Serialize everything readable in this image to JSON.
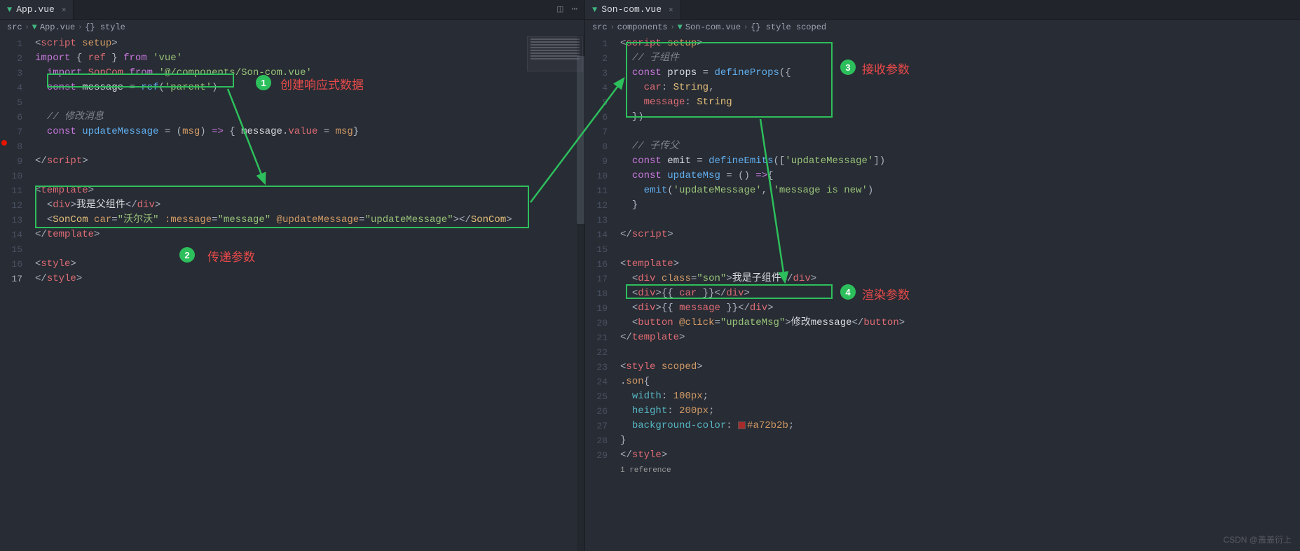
{
  "left": {
    "tab": {
      "name": "App.vue"
    },
    "breadcrumb": [
      "src",
      "App.vue",
      "{} style"
    ],
    "lines": {
      "1": [
        {
          "t": "<",
          "c": "c-tag"
        },
        {
          "t": "script",
          "c": "c-var"
        },
        {
          "t": " setup",
          "c": "c-attr"
        },
        {
          "t": ">",
          "c": "c-tag"
        }
      ],
      "2": [
        {
          "t": "import",
          "c": "c-keyword"
        },
        {
          "t": " { "
        },
        {
          "t": "ref",
          "c": "c-var"
        },
        {
          "t": " } "
        },
        {
          "t": "from",
          "c": "c-keyword"
        },
        {
          "t": " "
        },
        {
          "t": "'vue'",
          "c": "c-string"
        }
      ],
      "3": [
        {
          "t": "  "
        },
        {
          "t": "import",
          "c": "c-keyword"
        },
        {
          "t": " "
        },
        {
          "t": "SonCom",
          "c": "c-var"
        },
        {
          "t": " "
        },
        {
          "t": "from",
          "c": "c-keyword"
        },
        {
          "t": " "
        },
        {
          "t": "'@/components/Son-com.vue'",
          "c": "c-string"
        }
      ],
      "4": [
        {
          "t": "  "
        },
        {
          "t": "const",
          "c": "c-keyword"
        },
        {
          "t": " "
        },
        {
          "t": "message",
          "c": "c-white"
        },
        {
          "t": " = "
        },
        {
          "t": "ref",
          "c": "c-blue"
        },
        {
          "t": "("
        },
        {
          "t": "'parent'",
          "c": "c-string"
        },
        {
          "t": ")"
        }
      ],
      "5": [
        {
          "t": " "
        }
      ],
      "6": [
        {
          "t": "  "
        },
        {
          "t": "// 修改消息",
          "c": "c-comment"
        }
      ],
      "7": [
        {
          "t": "  "
        },
        {
          "t": "const",
          "c": "c-keyword"
        },
        {
          "t": " "
        },
        {
          "t": "updateMessage",
          "c": "c-blue"
        },
        {
          "t": " = ("
        },
        {
          "t": "msg",
          "c": "c-attr"
        },
        {
          "t": ") "
        },
        {
          "t": "=>",
          "c": "c-keyword"
        },
        {
          "t": " { "
        },
        {
          "t": "message",
          "c": "c-white"
        },
        {
          "t": "."
        },
        {
          "t": "value",
          "c": "c-var"
        },
        {
          "t": " = "
        },
        {
          "t": "msg",
          "c": "c-attr"
        },
        {
          "t": "}"
        }
      ],
      "8": [
        {
          "t": " "
        }
      ],
      "9": [
        {
          "t": "</",
          "c": "c-tag"
        },
        {
          "t": "script",
          "c": "c-var"
        },
        {
          "t": ">",
          "c": "c-tag"
        }
      ],
      "10": [
        {
          "t": " "
        }
      ],
      "11": [
        {
          "t": "<",
          "c": "c-tag"
        },
        {
          "t": "template",
          "c": "c-var"
        },
        {
          "t": ">",
          "c": "c-tag"
        }
      ],
      "12": [
        {
          "t": "  "
        },
        {
          "t": "<",
          "c": "c-tag"
        },
        {
          "t": "div",
          "c": "c-var"
        },
        {
          "t": ">",
          "c": "c-tag"
        },
        {
          "t": "我是父组件",
          "c": "c-white"
        },
        {
          "t": "</",
          "c": "c-tag"
        },
        {
          "t": "div",
          "c": "c-var"
        },
        {
          "t": ">",
          "c": "c-tag"
        }
      ],
      "13": [
        {
          "t": "  "
        },
        {
          "t": "<",
          "c": "c-tag"
        },
        {
          "t": "SonCom",
          "c": "c-component"
        },
        {
          "t": " "
        },
        {
          "t": "car",
          "c": "c-attr"
        },
        {
          "t": "="
        },
        {
          "t": "\"沃尔沃\"",
          "c": "c-string"
        },
        {
          "t": " "
        },
        {
          "t": ":message",
          "c": "c-attr"
        },
        {
          "t": "="
        },
        {
          "t": "\"message\"",
          "c": "c-string"
        },
        {
          "t": " "
        },
        {
          "t": "@updateMessage",
          "c": "c-attr"
        },
        {
          "t": "="
        },
        {
          "t": "\"updateMessage\"",
          "c": "c-string"
        },
        {
          "t": ">",
          "c": "c-tag"
        },
        {
          "t": "</",
          "c": "c-tag"
        },
        {
          "t": "SonCom",
          "c": "c-component"
        },
        {
          "t": ">",
          "c": "c-tag"
        }
      ],
      "14": [
        {
          "t": "</",
          "c": "c-tag"
        },
        {
          "t": "template",
          "c": "c-var"
        },
        {
          "t": ">",
          "c": "c-tag"
        }
      ],
      "15": [
        {
          "t": " "
        }
      ],
      "16": [
        {
          "t": "<",
          "c": "c-tag"
        },
        {
          "t": "style",
          "c": "c-var"
        },
        {
          "t": ">",
          "c": "c-tag"
        }
      ],
      "17": [
        {
          "t": "</",
          "c": "c-tag"
        },
        {
          "t": "style",
          "c": "c-var"
        },
        {
          "t": ">",
          "c": "c-tag"
        }
      ]
    },
    "annotations": {
      "1": "创建响应式数据",
      "2": "传递参数"
    }
  },
  "right": {
    "tab": {
      "name": "Son-com.vue"
    },
    "breadcrumb": [
      "src",
      "components",
      "Son-com.vue",
      "{} style scoped"
    ],
    "lines": {
      "1": [
        {
          "t": "<",
          "c": "c-tag"
        },
        {
          "t": "script",
          "c": "c-var"
        },
        {
          "t": " setup",
          "c": "c-attr"
        },
        {
          "t": ">",
          "c": "c-tag"
        }
      ],
      "2": [
        {
          "t": "  "
        },
        {
          "t": "// 子组件",
          "c": "c-comment"
        }
      ],
      "3": [
        {
          "t": "  "
        },
        {
          "t": "const",
          "c": "c-keyword"
        },
        {
          "t": " "
        },
        {
          "t": "props",
          "c": "c-white"
        },
        {
          "t": " = "
        },
        {
          "t": "defineProps",
          "c": "c-blue"
        },
        {
          "t": "({"
        }
      ],
      "4": [
        {
          "t": "    "
        },
        {
          "t": "car",
          "c": "c-var"
        },
        {
          "t": ": "
        },
        {
          "t": "String",
          "c": "c-component"
        },
        {
          "t": ","
        }
      ],
      "5": [
        {
          "t": "    "
        },
        {
          "t": "message",
          "c": "c-var"
        },
        {
          "t": ": "
        },
        {
          "t": "String",
          "c": "c-component"
        }
      ],
      "6": [
        {
          "t": "  })"
        }
      ],
      "7": [
        {
          "t": " "
        }
      ],
      "8": [
        {
          "t": "  "
        },
        {
          "t": "// 子传父",
          "c": "c-comment"
        }
      ],
      "9": [
        {
          "t": "  "
        },
        {
          "t": "const",
          "c": "c-keyword"
        },
        {
          "t": " "
        },
        {
          "t": "emit",
          "c": "c-white"
        },
        {
          "t": " = "
        },
        {
          "t": "defineEmits",
          "c": "c-blue"
        },
        {
          "t": "(["
        },
        {
          "t": "'updateMessage'",
          "c": "c-string"
        },
        {
          "t": "])"
        }
      ],
      "10": [
        {
          "t": "  "
        },
        {
          "t": "const",
          "c": "c-keyword"
        },
        {
          "t": " "
        },
        {
          "t": "updateMsg",
          "c": "c-blue"
        },
        {
          "t": " = () "
        },
        {
          "t": "=>",
          "c": "c-keyword"
        },
        {
          "t": "{"
        }
      ],
      "11": [
        {
          "t": "    "
        },
        {
          "t": "emit",
          "c": "c-blue"
        },
        {
          "t": "("
        },
        {
          "t": "'updateMessage'",
          "c": "c-string"
        },
        {
          "t": ", "
        },
        {
          "t": "'message is new'",
          "c": "c-string"
        },
        {
          "t": ")"
        }
      ],
      "12": [
        {
          "t": "  }"
        }
      ],
      "13": [
        {
          "t": " "
        }
      ],
      "14": [
        {
          "t": "</",
          "c": "c-tag"
        },
        {
          "t": "script",
          "c": "c-var"
        },
        {
          "t": ">",
          "c": "c-tag"
        }
      ],
      "15": [
        {
          "t": " "
        }
      ],
      "16": [
        {
          "t": "<",
          "c": "c-tag"
        },
        {
          "t": "template",
          "c": "c-var"
        },
        {
          "t": ">",
          "c": "c-tag"
        }
      ],
      "17": [
        {
          "t": "  "
        },
        {
          "t": "<",
          "c": "c-tag"
        },
        {
          "t": "div",
          "c": "c-var"
        },
        {
          "t": " "
        },
        {
          "t": "class",
          "c": "c-attr"
        },
        {
          "t": "="
        },
        {
          "t": "\"",
          "c": "c-string"
        },
        {
          "t": "son",
          "c": "c-string underline"
        },
        {
          "t": "\"",
          "c": "c-string"
        },
        {
          "t": ">",
          "c": "c-tag"
        },
        {
          "t": "我是子组件",
          "c": "c-white"
        },
        {
          "t": "</",
          "c": "c-tag"
        },
        {
          "t": "div",
          "c": "c-var"
        },
        {
          "t": ">",
          "c": "c-tag"
        }
      ],
      "18": [
        {
          "t": "  "
        },
        {
          "t": "<",
          "c": "c-tag"
        },
        {
          "t": "div",
          "c": "c-var"
        },
        {
          "t": ">",
          "c": "c-tag"
        },
        {
          "t": "{{ "
        },
        {
          "t": "car",
          "c": "c-var"
        },
        {
          "t": " }}"
        },
        {
          "t": "</",
          "c": "c-tag"
        },
        {
          "t": "div",
          "c": "c-var"
        },
        {
          "t": ">",
          "c": "c-tag"
        }
      ],
      "19": [
        {
          "t": "  "
        },
        {
          "t": "<",
          "c": "c-tag"
        },
        {
          "t": "div",
          "c": "c-var"
        },
        {
          "t": ">",
          "c": "c-tag"
        },
        {
          "t": "{{ "
        },
        {
          "t": "message",
          "c": "c-var"
        },
        {
          "t": " }}"
        },
        {
          "t": "</",
          "c": "c-tag"
        },
        {
          "t": "div",
          "c": "c-var"
        },
        {
          "t": ">",
          "c": "c-tag"
        }
      ],
      "20": [
        {
          "t": "  "
        },
        {
          "t": "<",
          "c": "c-tag"
        },
        {
          "t": "button",
          "c": "c-var"
        },
        {
          "t": " "
        },
        {
          "t": "@click",
          "c": "c-attr"
        },
        {
          "t": "="
        },
        {
          "t": "\"updateMsg\"",
          "c": "c-string"
        },
        {
          "t": ">",
          "c": "c-tag"
        },
        {
          "t": "修改message",
          "c": "c-white"
        },
        {
          "t": "</",
          "c": "c-tag"
        },
        {
          "t": "button",
          "c": "c-var"
        },
        {
          "t": ">",
          "c": "c-tag"
        }
      ],
      "21": [
        {
          "t": "</",
          "c": "c-tag"
        },
        {
          "t": "template",
          "c": "c-var"
        },
        {
          "t": ">",
          "c": "c-tag"
        }
      ],
      "22": [
        {
          "t": " "
        }
      ],
      "23": [
        {
          "t": "<",
          "c": "c-tag"
        },
        {
          "t": "style",
          "c": "c-var"
        },
        {
          "t": " scoped",
          "c": "c-attr"
        },
        {
          "t": ">",
          "c": "c-tag"
        }
      ],
      "ref": [
        {
          "t": "1 reference",
          "c": "c-ref"
        }
      ],
      "24": [
        {
          "t": "."
        },
        {
          "t": "son",
          "c": "c-attr"
        },
        {
          "t": "{"
        }
      ],
      "25": [
        {
          "t": "  "
        },
        {
          "t": "width",
          "c": "c-func"
        },
        {
          "t": ": "
        },
        {
          "t": "100px",
          "c": "c-attr"
        },
        {
          "t": ";"
        }
      ],
      "26": [
        {
          "t": "  "
        },
        {
          "t": "height",
          "c": "c-func"
        },
        {
          "t": ": "
        },
        {
          "t": "200px",
          "c": "c-attr"
        },
        {
          "t": ";"
        }
      ],
      "27": [
        {
          "t": "  "
        },
        {
          "t": "background-color",
          "c": "c-func"
        },
        {
          "t": ": "
        },
        {
          "t": "SWATCH",
          "c": "swatch"
        },
        {
          "t": "#a72b2b",
          "c": "c-attr"
        },
        {
          "t": ";"
        }
      ],
      "28": [
        {
          "t": "}"
        }
      ],
      "29": [
        {
          "t": "</",
          "c": "c-tag"
        },
        {
          "t": "style",
          "c": "c-var"
        },
        {
          "t": ">",
          "c": "c-tag"
        }
      ]
    },
    "annotations": {
      "3": "接收参数",
      "4": "渲染参数"
    }
  },
  "watermark": "CSDN @盖盖衍上"
}
